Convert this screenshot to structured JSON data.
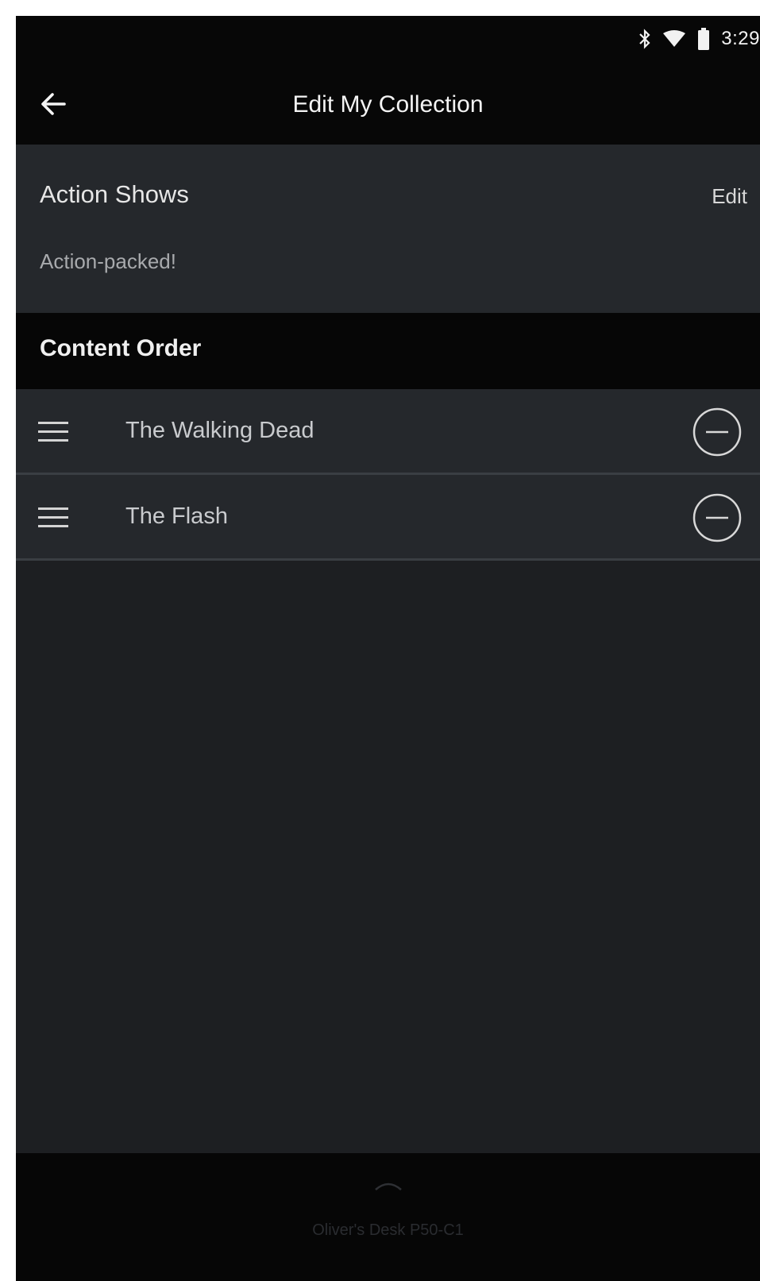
{
  "status_bar": {
    "time": "3:29",
    "icons": [
      "bluetooth-icon",
      "wifi-icon",
      "battery-icon"
    ]
  },
  "app_bar": {
    "back_icon": "arrow-left-icon",
    "title": "Edit My Collection"
  },
  "collection": {
    "name": "Action Shows",
    "edit_label": "Edit",
    "description": "Action-packed!"
  },
  "content_order": {
    "title": "Content Order",
    "items": [
      {
        "title": "The Walking Dead",
        "handle_icon": "drag-handle-icon",
        "remove_icon": "remove-circle-icon"
      },
      {
        "title": "The Flash",
        "handle_icon": "drag-handle-icon",
        "remove_icon": "remove-circle-icon"
      }
    ]
  },
  "bottom_bar": {
    "device_name": "Oliver's Desk P50-C1",
    "expand_icon": "chevron-up-icon"
  },
  "colors": {
    "background": "#1d1f22",
    "card": "#25282c",
    "header": "#060606",
    "text_primary": "#f0f0f0",
    "text_secondary": "#a8aaad"
  }
}
